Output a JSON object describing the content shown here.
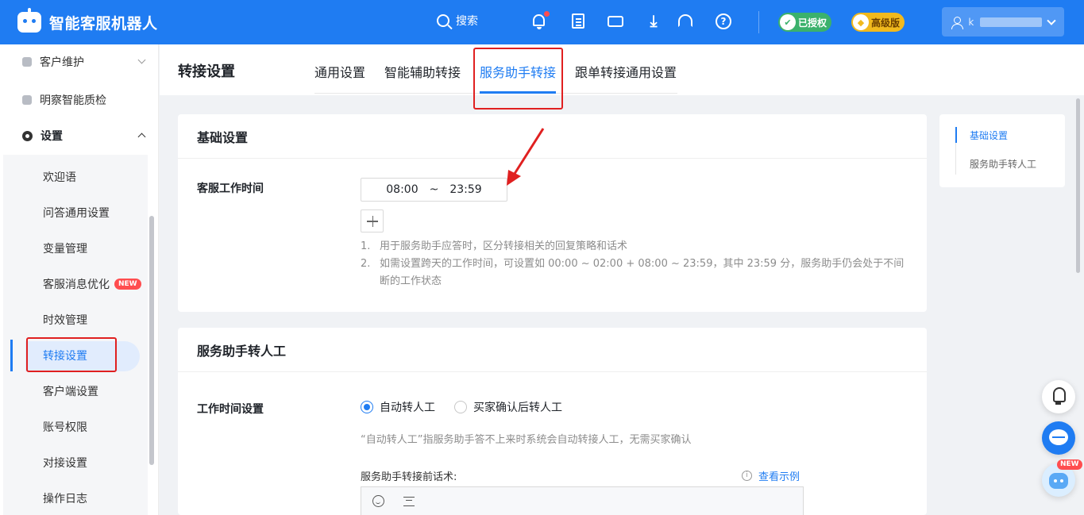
{
  "app": {
    "title": "智能客服机器人"
  },
  "header": {
    "search_label": "搜索",
    "authorized_label": "已授权",
    "edition_label": "高级版",
    "user_name": "k"
  },
  "sidebar": {
    "top_items": [
      {
        "label": "客户维护"
      },
      {
        "label": "明察智能质检"
      },
      {
        "label": "设置"
      }
    ],
    "sub_items": [
      {
        "label": "欢迎语"
      },
      {
        "label": "问答通用设置"
      },
      {
        "label": "变量管理"
      },
      {
        "label": "客服消息优化",
        "badge": "NEW"
      },
      {
        "label": "时效管理"
      },
      {
        "label": "转接设置"
      },
      {
        "label": "客户端设置"
      },
      {
        "label": "账号权限"
      },
      {
        "label": "对接设置"
      },
      {
        "label": "操作日志"
      }
    ],
    "active_item": "转接设置"
  },
  "page": {
    "title": "转接设置",
    "tabs": [
      {
        "label": "通用设置"
      },
      {
        "label": "智能辅助转接"
      },
      {
        "label": "服务助手转接"
      },
      {
        "label": "跟单转接通用设置"
      }
    ],
    "active_tab": "服务助手转接"
  },
  "basic": {
    "heading": "基础设置",
    "work_time_label": "客服工作时间",
    "start_time": "08:00",
    "separator": "~",
    "end_time": "23:59",
    "notes": [
      {
        "num": "1.",
        "text": "用于服务助手应答时，区分转接相关的回复策略和话术"
      },
      {
        "num": "2.",
        "text": "如需设置跨天的工作时间，可设置如 00:00 ~ 02:00 + 08:00 ~ 23:59，其中 23:59 分，服务助手仍会处于不间断的工作状态"
      }
    ]
  },
  "transfer": {
    "heading": "服务助手转人工",
    "work_time_setting_label": "工作时间设置",
    "options": [
      {
        "label": "自动转人工",
        "selected": true
      },
      {
        "label": "买家确认后转人工",
        "selected": false
      }
    ],
    "hint": "“自动转人工”指服务助手答不上来时系统会自动转接人工，无需买家确认",
    "pre_script_label": "服务助手转接前话术:",
    "example_link": "查看示例"
  },
  "anchor": {
    "items": [
      {
        "label": "基础设置"
      },
      {
        "label": "服务助手转人工"
      }
    ],
    "active": "基础设置"
  },
  "floats": {
    "new_badge": "NEW"
  },
  "colors": {
    "primary": "#1f7cf2",
    "highlight_box": "#e02020",
    "success": "#3bb16c",
    "gold": "#f1b91d"
  }
}
